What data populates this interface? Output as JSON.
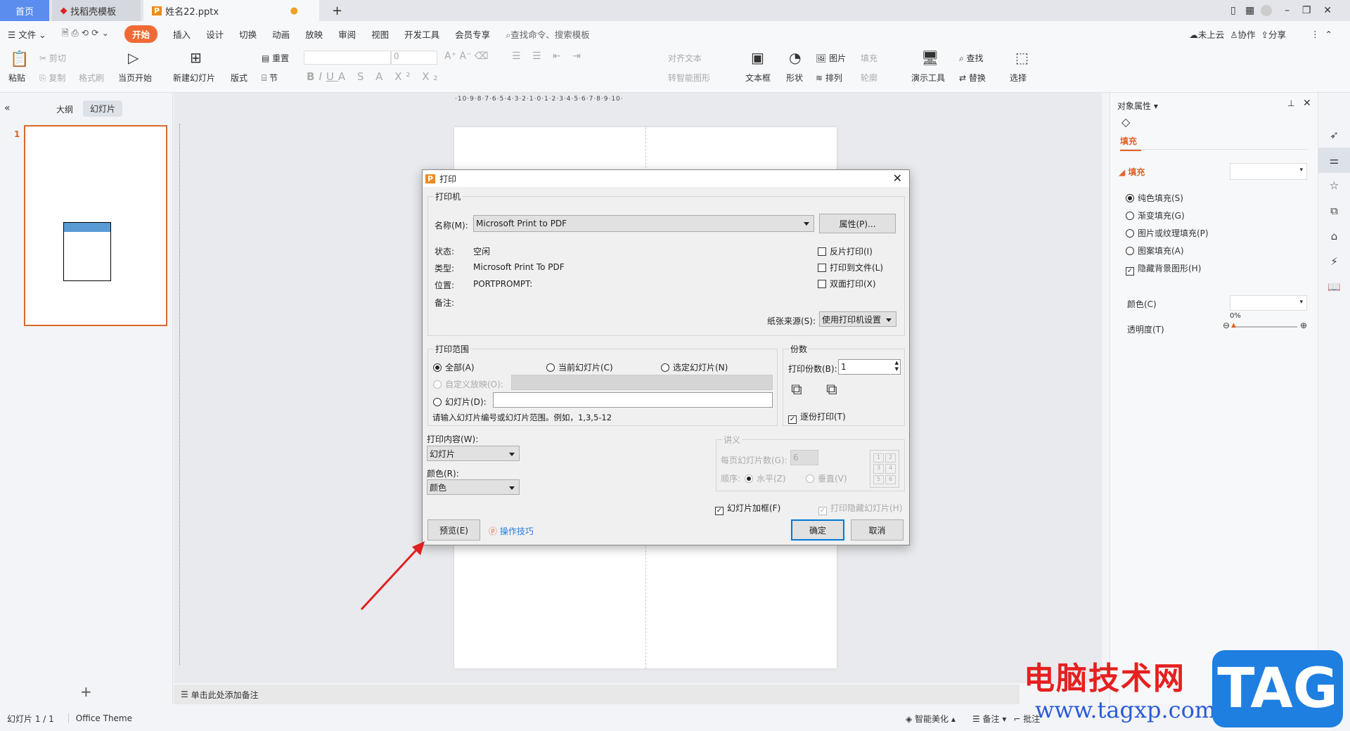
{
  "tabs": [
    {
      "label": "首页"
    },
    {
      "label": "找稻壳模板"
    },
    {
      "label": "姓名22.pptx"
    }
  ],
  "menu": {
    "file": "文件",
    "items": [
      "开始",
      "插入",
      "设计",
      "切换",
      "动画",
      "放映",
      "审阅",
      "视图",
      "开发工具",
      "会员专享"
    ],
    "search": "查找命令、搜索模板",
    "cloud": "未上云",
    "collab": "协作",
    "share": "分享"
  },
  "ribbon": {
    "paste": "粘贴",
    "cut": "剪切",
    "copy": "复制",
    "format_painter": "格式刷",
    "play_from_current": "当页开始",
    "new_slide": "新建幻灯片",
    "layout": "版式",
    "reset": "重置",
    "section": "节",
    "font_size": "0",
    "align_text": "对齐文本",
    "smart_art": "转智能图形",
    "textbox": "文本框",
    "shape": "形状",
    "picture": "图片",
    "fill": "填充",
    "arrange": "排列",
    "outline": "轮廓",
    "presenter_tools": "演示工具",
    "find": "查找",
    "replace": "替换",
    "select": "选择"
  },
  "left_panel": {
    "tab_outline": "大纲",
    "tab_slides": "幻灯片",
    "slide_number": "1"
  },
  "ruler": {
    "horizontal": "·10·9·8·7·6·5·4·3·2·1·0·1·2·3·4·5·6·7·8·9·10·"
  },
  "notes": {
    "placeholder": "单击此处添加备注"
  },
  "status": {
    "slide_count": "幻灯片 1 / 1",
    "theme": "Office Theme",
    "beautify": "智能美化",
    "notes": "备注",
    "comment": "批注"
  },
  "right_panel": {
    "title": "对象属性",
    "tab": "填充",
    "section": "填充",
    "options": [
      "纯色填充(S)",
      "渐变填充(G)",
      "图片或纹理填充(P)",
      "图案填充(A)"
    ],
    "hide_bg": "隐藏背景图形(H)",
    "color_label": "颜色(C)",
    "transparency_label": "透明度(T)",
    "transparency_value": "0%"
  },
  "dialog": {
    "title": "打印",
    "printer_group": "打印机",
    "name_label": "名称(M):",
    "name_value": "Microsoft Print to PDF",
    "properties": "属性(P)...",
    "status_label": "状态:",
    "status_value": "空闲",
    "type_label": "类型:",
    "type_value": "Microsoft Print To PDF",
    "where_label": "位置:",
    "where_value": "PORTPROMPT:",
    "comment_label": "备注:",
    "reverse": "反片打印(I)",
    "to_file": "打印到文件(L)",
    "duplex": "双面打印(X)",
    "paper_source_label": "纸张来源(S):",
    "paper_source_value": "使用打印机设置",
    "range_group": "打印范围",
    "all": "全部(A)",
    "current": "当前幻灯片(C)",
    "selected": "选定幻灯片(N)",
    "custom": "自定义放映(O):",
    "slides": "幻灯片(D):",
    "hint": "请输入幻灯片编号或幻灯片范围。例如，1,3,5-12",
    "copies_group": "份数",
    "copies_label": "打印份数(B):",
    "copies_value": "1",
    "collate": "逐份打印(T)",
    "content_label": "打印内容(W):",
    "content_value": "幻灯片",
    "color_label": "颜色(R):",
    "color_value": "颜色",
    "handout_group": "讲义",
    "per_page_label": "每页幻灯片数(G):",
    "per_page_value": "6",
    "order_label": "顺序:",
    "horizontal": "水平(Z)",
    "vertical": "垂直(V)",
    "handout_nums": [
      "1",
      "2",
      "3",
      "4",
      "5",
      "6"
    ],
    "frame": "幻灯片加框(F)",
    "print_hidden": "打印隐藏幻灯片(H)",
    "preview": "预览(E)",
    "tips": "操作技巧",
    "ok": "确定",
    "cancel": "取消"
  },
  "watermark": {
    "cn": "电脑技术网",
    "url": "www.tagxp.com",
    "logo": "TAG"
  },
  "colors": {
    "accent": "#f06a35",
    "home_tab": "#5b8def",
    "ok_border": "#0078d7"
  }
}
